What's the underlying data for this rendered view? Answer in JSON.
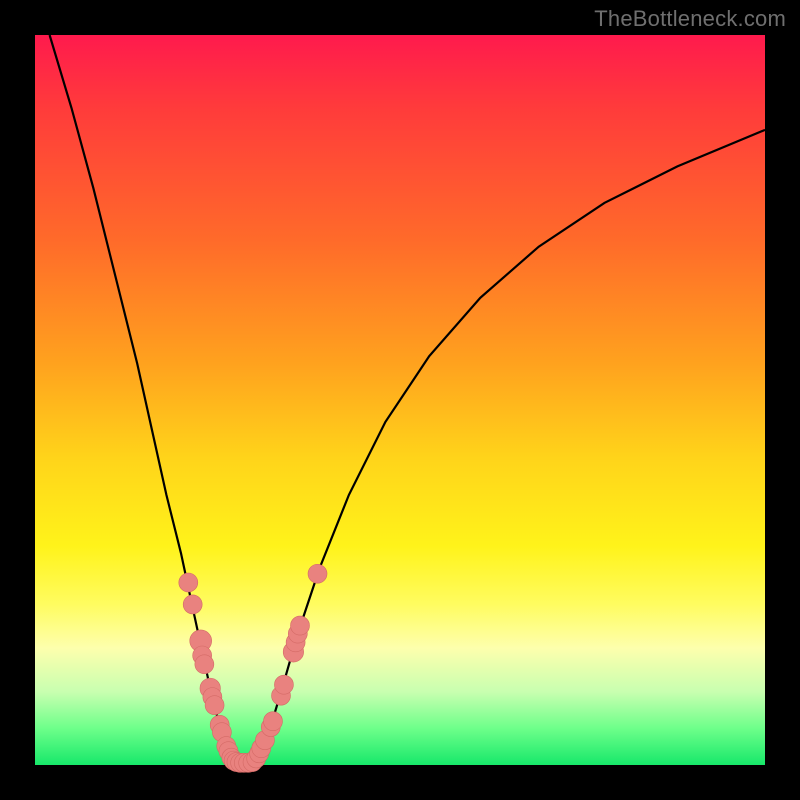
{
  "watermark": "TheBottleneck.com",
  "colors": {
    "background": "#000000",
    "curve": "#000000",
    "marker_fill": "#e9827f",
    "marker_stroke": "#d46a66"
  },
  "chart_data": {
    "type": "line",
    "title": "",
    "xlabel": "",
    "ylabel": "",
    "xlim": [
      0,
      100
    ],
    "ylim": [
      0,
      100
    ],
    "grid": false,
    "series": [
      {
        "name": "left-branch",
        "x": [
          2,
          5,
          8,
          11,
          14,
          16,
          18,
          20,
          21.5,
          22.8,
          24,
          25,
          25.8,
          26.4,
          27
        ],
        "y": [
          100,
          90,
          79,
          67,
          55,
          46,
          37,
          29,
          22,
          16,
          10.5,
          6.5,
          3.5,
          1.5,
          0.5
        ]
      },
      {
        "name": "right-branch",
        "x": [
          30,
          31,
          32.5,
          34,
          36,
          39,
          43,
          48,
          54,
          61,
          69,
          78,
          88,
          100
        ],
        "y": [
          0.5,
          2.5,
          6,
          11,
          18,
          27,
          37,
          47,
          56,
          64,
          71,
          77,
          82,
          87
        ]
      }
    ],
    "markers": [
      {
        "x": 21.0,
        "y": 25.0,
        "r": 1.3
      },
      {
        "x": 21.6,
        "y": 22.0,
        "r": 1.3
      },
      {
        "x": 22.7,
        "y": 17.0,
        "r": 1.5
      },
      {
        "x": 22.9,
        "y": 15.0,
        "r": 1.3
      },
      {
        "x": 23.2,
        "y": 13.8,
        "r": 1.3
      },
      {
        "x": 24.0,
        "y": 10.5,
        "r": 1.4
      },
      {
        "x": 24.3,
        "y": 9.3,
        "r": 1.3
      },
      {
        "x": 24.6,
        "y": 8.2,
        "r": 1.3
      },
      {
        "x": 25.3,
        "y": 5.5,
        "r": 1.3
      },
      {
        "x": 25.6,
        "y": 4.5,
        "r": 1.3
      },
      {
        "x": 26.2,
        "y": 2.6,
        "r": 1.3
      },
      {
        "x": 26.5,
        "y": 1.9,
        "r": 1.3
      },
      {
        "x": 26.9,
        "y": 1.0,
        "r": 1.3
      },
      {
        "x": 27.2,
        "y": 0.6,
        "r": 1.3
      },
      {
        "x": 27.6,
        "y": 0.4,
        "r": 1.3
      },
      {
        "x": 28.1,
        "y": 0.3,
        "r": 1.3
      },
      {
        "x": 28.6,
        "y": 0.3,
        "r": 1.3
      },
      {
        "x": 29.2,
        "y": 0.3,
        "r": 1.3
      },
      {
        "x": 29.8,
        "y": 0.4,
        "r": 1.3
      },
      {
        "x": 30.3,
        "y": 0.9,
        "r": 1.3
      },
      {
        "x": 30.7,
        "y": 1.6,
        "r": 1.3
      },
      {
        "x": 31.0,
        "y": 2.3,
        "r": 1.3
      },
      {
        "x": 31.5,
        "y": 3.4,
        "r": 1.3
      },
      {
        "x": 32.3,
        "y": 5.2,
        "r": 1.3
      },
      {
        "x": 32.6,
        "y": 6.0,
        "r": 1.3
      },
      {
        "x": 33.7,
        "y": 9.5,
        "r": 1.3
      },
      {
        "x": 34.1,
        "y": 11.0,
        "r": 1.3
      },
      {
        "x": 35.4,
        "y": 15.5,
        "r": 1.4
      },
      {
        "x": 35.7,
        "y": 16.8,
        "r": 1.3
      },
      {
        "x": 36.0,
        "y": 18.0,
        "r": 1.3
      },
      {
        "x": 36.3,
        "y": 19.1,
        "r": 1.3
      },
      {
        "x": 38.7,
        "y": 26.2,
        "r": 1.3
      }
    ]
  }
}
